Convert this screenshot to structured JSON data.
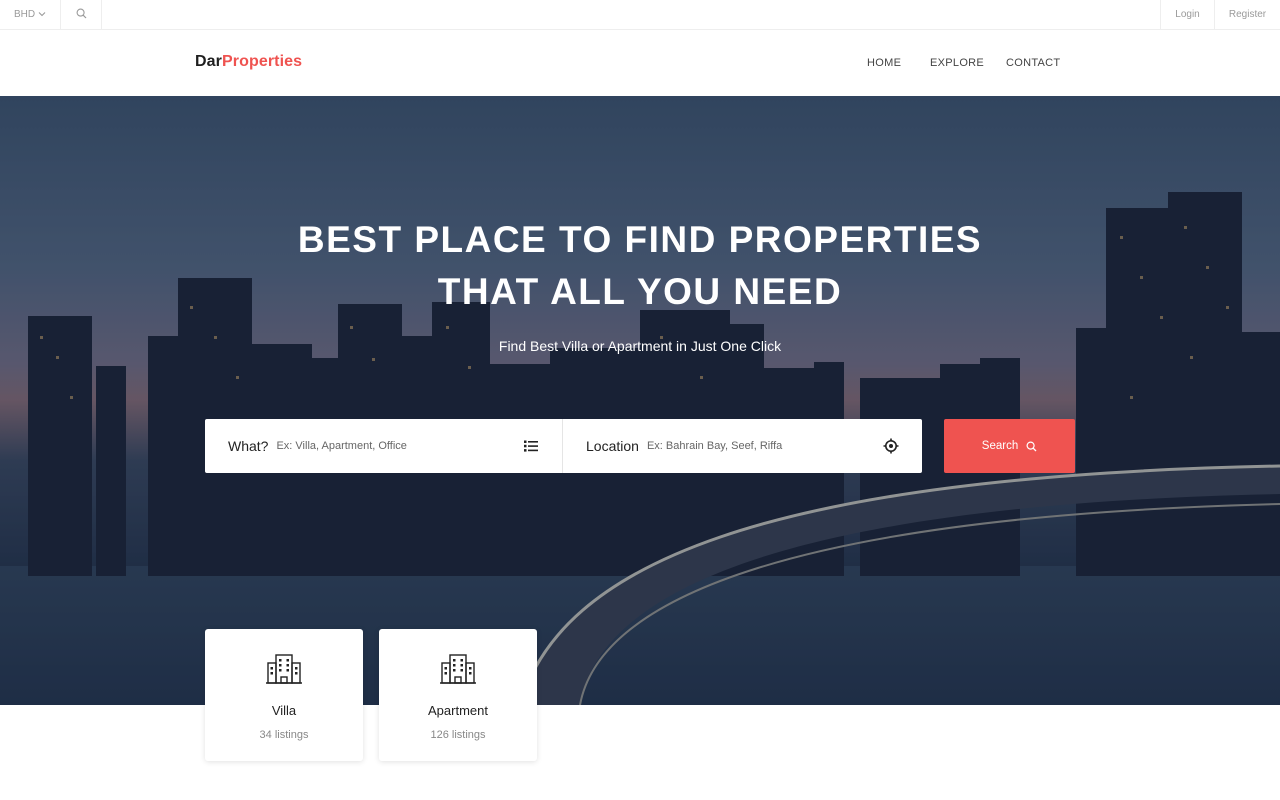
{
  "topbar": {
    "currency": "BHD",
    "login": "Login",
    "register": "Register"
  },
  "header": {
    "logo_part1": "Dar",
    "logo_part2": "Properties",
    "nav": [
      "HOME",
      "EXPLORE",
      "CONTACT"
    ]
  },
  "hero": {
    "title_line1": "BEST PLACE TO FIND PROPERTIES",
    "title_line2": "THAT ALL YOU NEED",
    "subtitle": "Find Best Villa or Apartment in Just One Click"
  },
  "search": {
    "what_label": "What?",
    "what_placeholder": "Ex: Villa, Apartment, Office",
    "location_label": "Location",
    "location_placeholder": "Ex: Bahrain Bay, Seef, Riffa",
    "button_label": "Search"
  },
  "categories": [
    {
      "name": "Villa",
      "count": "34 listings"
    },
    {
      "name": "Apartment",
      "count": "126 listings"
    }
  ],
  "colors": {
    "accent": "#ef5350",
    "text_dark": "#1f1f1f"
  },
  "icons": {
    "currency_dropdown": "chevron-down-icon",
    "top_search": "search-icon",
    "what_field": "list-icon",
    "location_field": "crosshair-icon",
    "search_button": "search-icon",
    "category": "building-icon"
  }
}
